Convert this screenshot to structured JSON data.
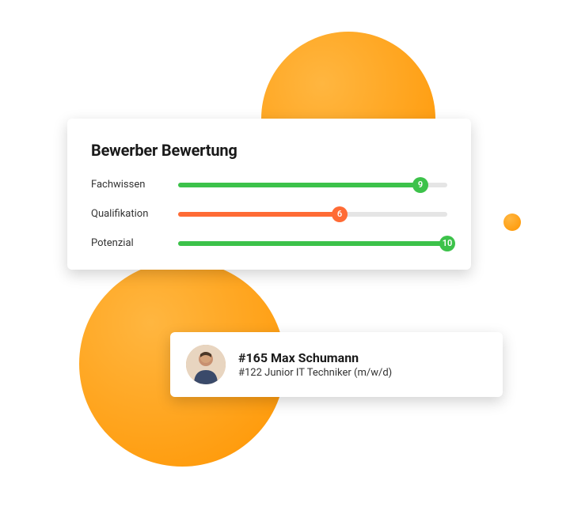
{
  "colors": {
    "green": "#3cc24a",
    "orange": "#ff6b35"
  },
  "rating": {
    "title": "Bewerber Bewertung",
    "max": 10,
    "items": [
      {
        "label": "Fachwissen",
        "value": 9,
        "color": "green"
      },
      {
        "label": "Qualifikation",
        "value": 6,
        "color": "orange"
      },
      {
        "label": "Potenzial",
        "value": 10,
        "color": "green"
      }
    ]
  },
  "candidate": {
    "name": "#165 Max Schumann",
    "role": "#122 Junior IT Techniker (m/w/d)"
  }
}
